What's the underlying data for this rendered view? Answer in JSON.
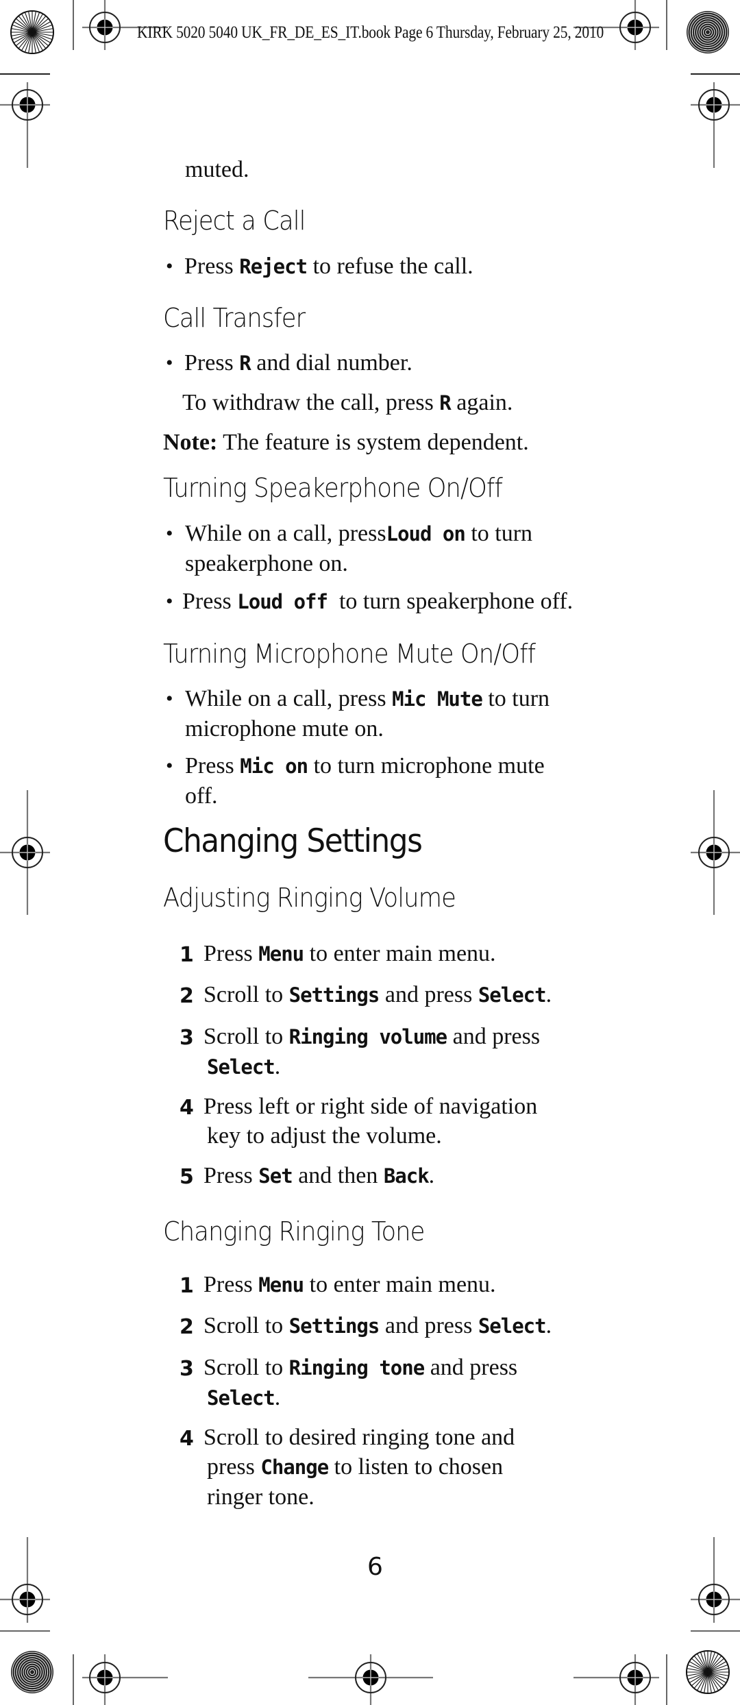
{
  "header": {
    "running_head": "KIRK 5020 5040 UK_FR_DE_ES_IT.book  Page 6  Thursday, February 25, 2010"
  },
  "content": {
    "continuation": "muted.",
    "reject": {
      "title": "Reject a Call",
      "bullet": {
        "pre": "Press ",
        "key": "Reject",
        "post": " to refuse the call."
      }
    },
    "transfer": {
      "title": "Call Transfer",
      "bullet": {
        "pre": "Press ",
        "key": "R",
        "post": " and dial number."
      },
      "sub": {
        "pre": "To withdraw the call, press ",
        "key": "R",
        "post": " again."
      },
      "note_label": "Note:",
      "note_text": " The feature is system dependent."
    },
    "speaker": {
      "title": "Turning Speakerphone On/Off",
      "bullet1": {
        "pre": "While on a call, press",
        "key": "Loud on",
        "post": " to turn",
        "line2": "speakerphone on."
      },
      "bullet2": {
        "pre": "Press ",
        "key": "Loud off",
        "post": "  to turn speakerphone off."
      }
    },
    "mic": {
      "title": "Turning Microphone Mute On/Off",
      "bullet1": {
        "pre": "While on a call, press ",
        "key": "Mic Mute",
        "post": " to turn",
        "line2": "microphone mute on."
      },
      "bullet2": {
        "pre": "Press ",
        "key": "Mic on",
        "post": " to turn microphone mute",
        "line2": "off."
      }
    },
    "settings": {
      "title": "Changing Settings",
      "volume": {
        "title": "Adjusting Ringing Volume",
        "steps": [
          {
            "num": "1",
            "pre": "Press ",
            "key": "Menu",
            "post": " to enter main menu."
          },
          {
            "num": "2",
            "pre": "Scroll to ",
            "key": "Settings",
            "mid": " and press ",
            "key2": "Select",
            "post": "."
          },
          {
            "num": "3",
            "pre": "Scroll to ",
            "key": "Ringing volume",
            "post": " and press",
            "line2_key": "Select",
            "line2_post": "."
          },
          {
            "num": "4",
            "pre": "Press left or right side of navigation",
            "line2": "key to adjust the volume."
          },
          {
            "num": "5",
            "pre": "Press ",
            "key": "Set",
            "mid": " and then ",
            "key2": "Back",
            "post": "."
          }
        ]
      },
      "tone": {
        "title": "Changing Ringing Tone",
        "steps": [
          {
            "num": "1",
            "pre": "Press ",
            "key": "Menu",
            "post": " to enter main menu."
          },
          {
            "num": "2",
            "pre": "Scroll to ",
            "key": "Settings",
            "mid": " and press ",
            "key2": "Select",
            "post": "."
          },
          {
            "num": "3",
            "pre": "Scroll to ",
            "key": "Ringing tone",
            "post": " and press",
            "line2_key": "Select",
            "line2_post": "."
          },
          {
            "num": "4",
            "pre": "Scroll to desired ringing tone and",
            "line2_pre": "press ",
            "line2_key": "Change",
            "line2_post": " to listen to chosen",
            "line3": "ringer tone."
          }
        ]
      }
    }
  },
  "footer": {
    "page_number": "6"
  }
}
